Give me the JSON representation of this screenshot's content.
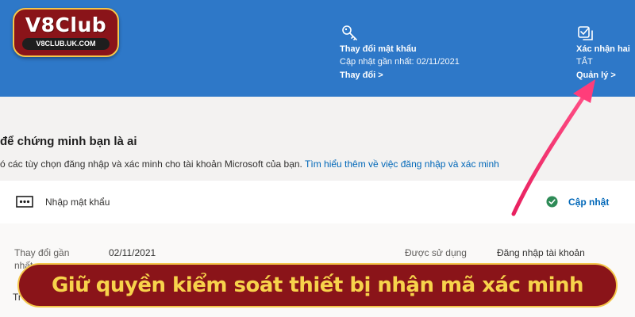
{
  "logo": {
    "title": "V8Club",
    "url": "V8CLUB.UK.COM"
  },
  "header": {
    "password_card": {
      "icon": "key-icon",
      "title": "Thay đổi mật khẩu",
      "subtitle": "Cập nhật gần nhất: 02/11/2021",
      "link": "Thay đổi >"
    },
    "verification_card": {
      "icon": "checkbox-icon",
      "title": "Xác nhận hai",
      "subtitle": "TẮT",
      "link": "Quản lý >"
    }
  },
  "main": {
    "heading": "để chứng minh bạn là ai",
    "description": "ó các tùy chọn đăng nhập và xác minh cho tài khoản Microsoft của bạn.",
    "learn_more": "Tìm hiểu thêm về việc đăng nhập và xác minh",
    "password_row": {
      "icon": "password-dots-icon",
      "label": "Nhập mật khẩu",
      "status_icon": "check-circle-icon",
      "update_link": "Cập nhật"
    },
    "details": {
      "changed_label": "Thay đổi gần",
      "changed_label_2": "nhất",
      "changed_value": "02/11/2021",
      "used_label": "Được sử dụng",
      "used_value": "Đăng nhập tài khoản",
      "extra_text": "Tr"
    }
  },
  "banner": {
    "text": "Giữ quyền kiểm soát thiết bị nhận mã xác minh"
  },
  "colors": {
    "header_blue": "#2e78c8",
    "brand_red": "#8a1419",
    "banner_yellow": "#f7d34b",
    "arrow_pink": "#f0356f",
    "link_blue": "#0067b8",
    "check_green": "#2e8b57"
  }
}
